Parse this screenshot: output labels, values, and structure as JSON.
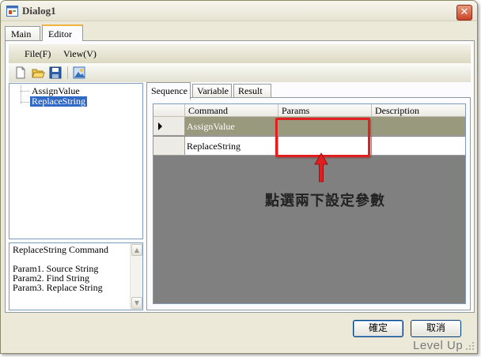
{
  "window": {
    "title": "Dialog1",
    "close_label": "✕"
  },
  "tabs": [
    {
      "label": "Main"
    },
    {
      "label": "Editor"
    }
  ],
  "menu": {
    "file": "File(F)",
    "view": "View(V)"
  },
  "toolbar": [
    {
      "icon": "new-file-icon"
    },
    {
      "icon": "open-folder-icon"
    },
    {
      "icon": "save-icon"
    },
    {
      "icon": "image-icon"
    }
  ],
  "tree": {
    "items": [
      {
        "label": "AssignValue"
      },
      {
        "label": "ReplaceString",
        "selected": true
      }
    ]
  },
  "description": {
    "text": "ReplaceString Command\n\nParam1. Source String\nParam2. Find String\nParam3. Replace String"
  },
  "inner_tabs": [
    {
      "label": "Sequence"
    },
    {
      "label": "Variable"
    },
    {
      "label": "Result"
    }
  ],
  "grid": {
    "columns": [
      "Command",
      "Params",
      "Description"
    ],
    "rows": [
      {
        "command": "AssignValue",
        "params": "",
        "description": "",
        "current": true
      },
      {
        "command": "ReplaceString",
        "params": "",
        "description": ""
      }
    ]
  },
  "annotation": {
    "text": "點選兩下設定參數",
    "color": "#e02020"
  },
  "buttons": {
    "ok": "確定",
    "cancel": "取消"
  },
  "watermark": "Level Up",
  "colors": {
    "selected_tree": "#3169c6",
    "current_row": "#99997e",
    "grid_bg": "#808080"
  }
}
